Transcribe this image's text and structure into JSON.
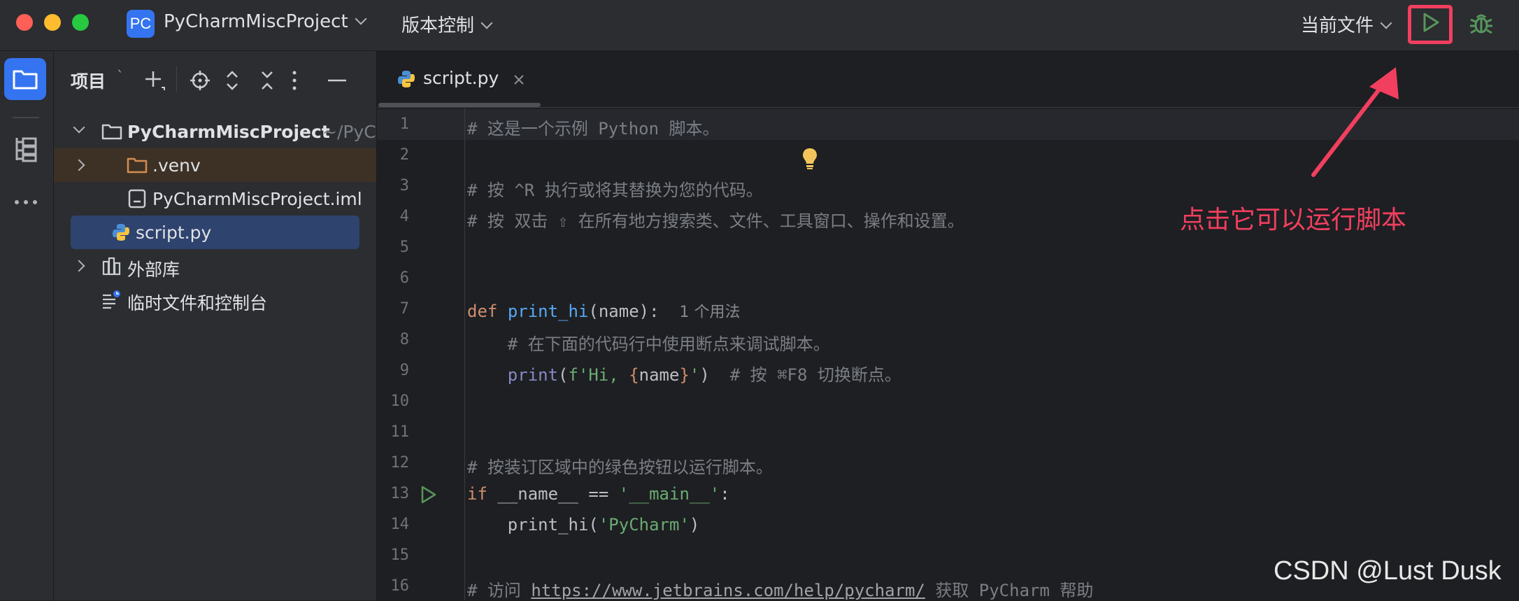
{
  "titlebar": {
    "project_badge": "PC",
    "project_name": "PyCharmMiscProject",
    "vcs_menu": "版本控制",
    "run_config": "当前文件",
    "icons": [
      "run-icon",
      "debug-icon"
    ]
  },
  "colors": {
    "accent": "#3574f0",
    "run_green": "#57965c",
    "annotation_red": "#f23f5f"
  },
  "project_panel": {
    "title": "项目",
    "tree": [
      {
        "label": "PyCharmMiscProject",
        "suffix": "~/PyC",
        "icon": "folder-icon",
        "expanded": true
      },
      {
        "label": ".venv",
        "icon": "folder-icon",
        "expanded": false
      },
      {
        "label": "PyCharmMiscProject.iml",
        "icon": "file-icon"
      },
      {
        "label": "script.py",
        "icon": "python-icon",
        "selected": true
      },
      {
        "label": "外部库",
        "icon": "library-icon",
        "expanded": false
      },
      {
        "label": "临时文件和控制台",
        "icon": "scratch-icon"
      }
    ]
  },
  "editor": {
    "tab_label": "script.py",
    "lines": [
      {
        "n": "1",
        "text": "# 这是一个示例 Python 脚本。"
      },
      {
        "n": "2",
        "text": ""
      },
      {
        "n": "3",
        "text": "# 按 ^R 执行或将其替换为您的代码。"
      },
      {
        "n": "4",
        "text": "# 按 双击 ⇧ 在所有地方搜索类、文件、工具窗口、操作和设置。"
      },
      {
        "n": "5",
        "text": ""
      },
      {
        "n": "6",
        "text": ""
      },
      {
        "n": "7",
        "kw": "def",
        "fn": "print_hi",
        "rest": "(name):",
        "hint": "1 个用法"
      },
      {
        "n": "8",
        "text": "    # 在下面的代码行中使用断点来调试脚本。"
      },
      {
        "n": "9",
        "bi": "print",
        "str1": "f'Hi, ",
        "lb": "{",
        "var": "name",
        "rb": "}",
        "str2": "'",
        "close": ")",
        "comment": "# 按 ⌘F8 切换断点。"
      },
      {
        "n": "10",
        "text": ""
      },
      {
        "n": "11",
        "text": ""
      },
      {
        "n": "12",
        "text": "# 按装订区域中的绿色按钮以运行脚本。"
      },
      {
        "n": "13",
        "kw": "if",
        "rest": " __name__ == ",
        "str": "'__main__'",
        "end": ":"
      },
      {
        "n": "14",
        "call": "print_hi(",
        "str": "'PyCharm'",
        "close": ")"
      },
      {
        "n": "15",
        "text": ""
      },
      {
        "n": "16",
        "pre": "# 访问 ",
        "url": "https://www.jetbrains.com/help/pycharm/",
        "post": " 获取 PyCharm 帮助"
      }
    ]
  },
  "annotation": "点击它可以运行脚本",
  "watermark": "CSDN @Lust Dusk"
}
